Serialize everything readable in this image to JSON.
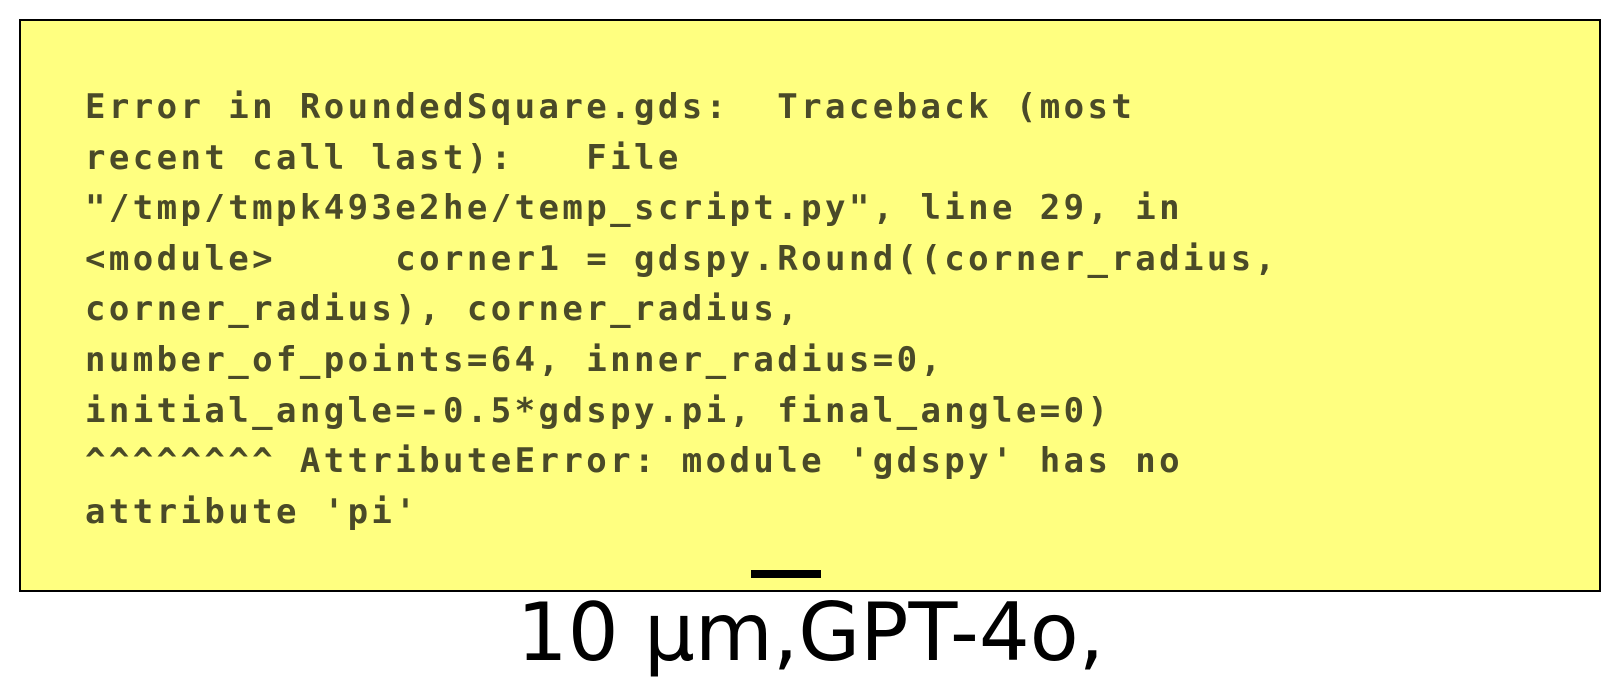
{
  "error_panel": {
    "lines": [
      "Error in RoundedSquare.gds:  Traceback (most",
      "recent call last):   File",
      "\"/tmp/tmpk493e2he/temp_script.py\", line 29, in",
      "<module>     corner1 = gdspy.Round((corner_radius,",
      "corner_radius), corner_radius,",
      "number_of_points=64, inner_radius=0,",
      "initial_angle=-0.5*gdspy.pi, final_angle=0)",
      "^^^^^^^^ AttributeError: module 'gdspy' has no",
      "attribute 'pi'"
    ],
    "background_color": "#ffff80",
    "text_color": "#4a4a28"
  },
  "caption": {
    "text": "10 μm,GPT-4o,"
  }
}
